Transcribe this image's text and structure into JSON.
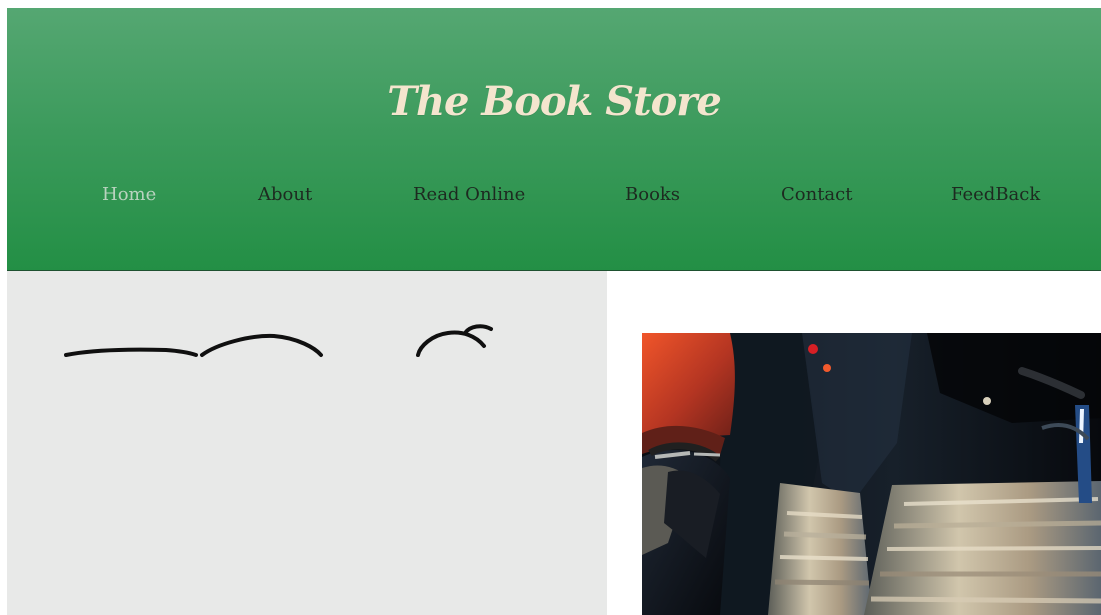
{
  "header": {
    "title": "The Book Store",
    "background_top": "#55a772",
    "background_bottom": "#238f45"
  },
  "nav": {
    "items": [
      {
        "label": "Home",
        "active": true
      },
      {
        "label": "About",
        "active": false
      },
      {
        "label": "Read Online",
        "active": false
      },
      {
        "label": "Books",
        "active": false
      },
      {
        "label": "Contact",
        "active": false
      },
      {
        "label": "FeedBack",
        "active": false
      }
    ]
  },
  "colors": {
    "title": "#f4e5ce",
    "nav_text": "#1d2a20",
    "nav_active": "#b9d3bf",
    "left_panel": "#e8e9e8"
  },
  "icons": {
    "hero_image": "bookstore-reading-photo",
    "partial_script": "script-logo-fragment"
  }
}
